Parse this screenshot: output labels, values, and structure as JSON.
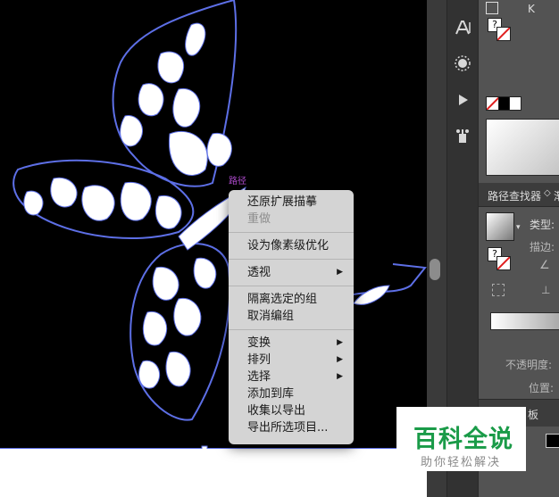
{
  "context_menu": {
    "items": [
      {
        "label": "还原扩展描摹",
        "disabled": false
      },
      {
        "label": "重做",
        "disabled": true
      },
      {
        "label": "设为像素级优化"
      },
      {
        "label": "透视",
        "submenu": true
      },
      {
        "label": "隔离选定的组"
      },
      {
        "label": "取消编组"
      },
      {
        "label": "变换",
        "submenu": true
      },
      {
        "label": "排列",
        "submenu": true
      },
      {
        "label": "选择",
        "submenu": true
      },
      {
        "label": "添加到库"
      },
      {
        "label": "收集以导出"
      },
      {
        "label": "导出所选项目..."
      }
    ],
    "submenu_glyph": "▶"
  },
  "panel": {
    "top_letter": "K",
    "swatch_q": "?",
    "pathfinder_tab": "路径查找器",
    "tab_arrow": "◇",
    "next_tab_fragment": "渐",
    "type_label": "类型:",
    "stroke_label": "描边:",
    "opacity_label": "不透明度:",
    "position_label": "位置:",
    "bottom_tab_fragment": "板"
  },
  "canvas": {
    "anchor_label": "路径"
  },
  "watermark": {
    "title": "百科全说",
    "subtitle": "助你轻松解决"
  },
  "colors": {
    "canvas_bg": "#000000",
    "outline": "#5d6fe6",
    "menu_bg": "#d4d4d4",
    "panel_bg": "#535353",
    "watermark_green": "#1a9b48"
  },
  "icons": [
    "type-tool-icon",
    "star-burst-icon",
    "play-icon",
    "puppet-warp-icon"
  ]
}
